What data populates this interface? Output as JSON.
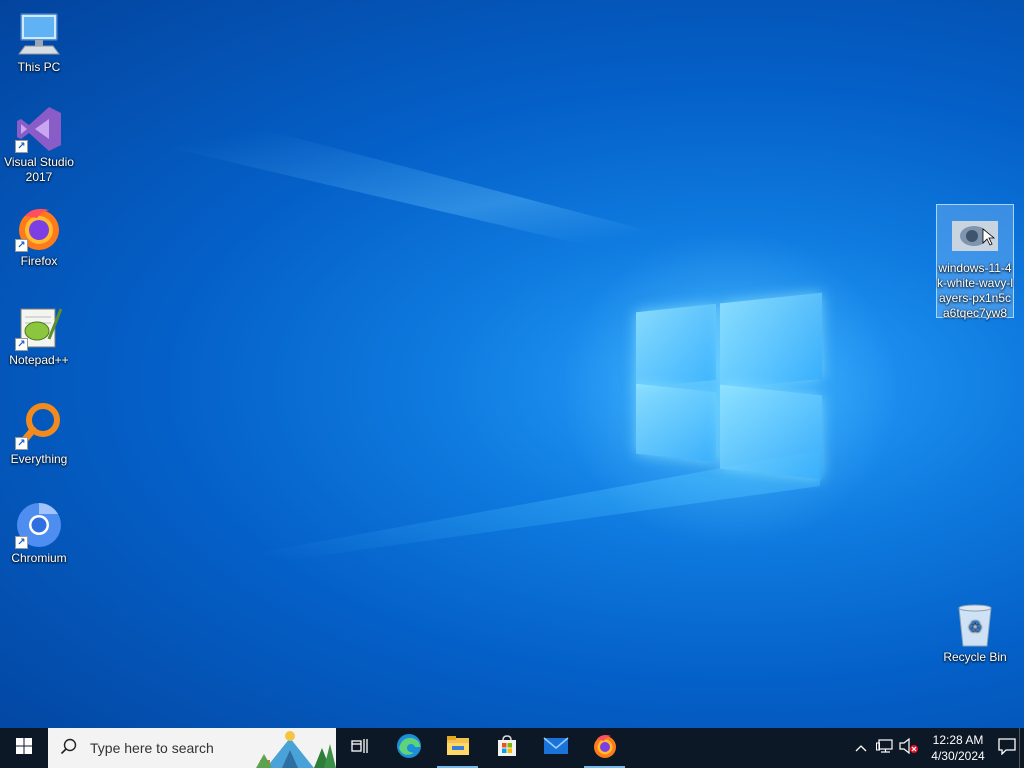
{
  "desktop": {
    "icons": [
      {
        "label": "This PC"
      },
      {
        "label": "Visual Studio 2017"
      },
      {
        "label": "Firefox"
      },
      {
        "label": "Notepad++"
      },
      {
        "label": "Everything"
      },
      {
        "label": "Chromium"
      }
    ],
    "selected_file": {
      "label": "windows-11-4k-white-wavy-layers-px1n5ca6tqec7yw8"
    },
    "recycle_bin": {
      "label": "Recycle Bin"
    }
  },
  "taskbar": {
    "search_placeholder": "Type here to search",
    "apps": [
      {
        "icon": "task-view-icon"
      },
      {
        "icon": "edge-icon"
      },
      {
        "icon": "file-explorer-icon"
      },
      {
        "icon": "microsoft-store-icon"
      },
      {
        "icon": "mail-icon"
      },
      {
        "icon": "firefox-icon",
        "active": true
      }
    ],
    "clock": {
      "time": "12:28 AM",
      "date": "4/30/2024"
    }
  },
  "colors": {
    "taskbar_bg": "#0d1827",
    "wallpaper": "#0f7be0",
    "active_indicator": "#76b9ed"
  }
}
